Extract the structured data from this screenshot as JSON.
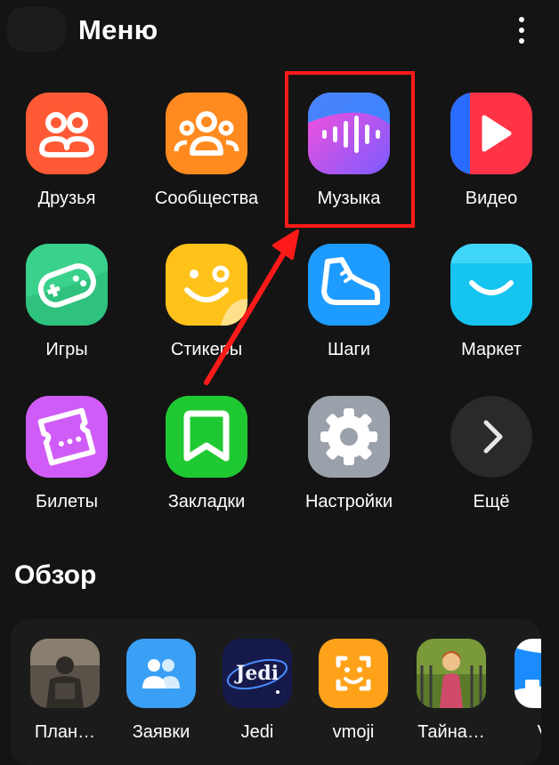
{
  "header": {
    "title": "Меню"
  },
  "menu": {
    "items": [
      {
        "label": "Друзья",
        "icon": "friends-icon",
        "color": "#ff5a36"
      },
      {
        "label": "Сообщества",
        "icon": "communities-icon",
        "color": "#ff8a1f"
      },
      {
        "label": "Музыка",
        "icon": "music-icon",
        "color": "#b35cff"
      },
      {
        "label": "Видео",
        "icon": "video-icon",
        "color": "#ff3347"
      },
      {
        "label": "Игры",
        "icon": "gamepad-icon",
        "color": "#2ec27e"
      },
      {
        "label": "Стикеры",
        "icon": "sticker-icon",
        "color": "#ffc21a"
      },
      {
        "label": "Шаги",
        "icon": "sneaker-icon",
        "color": "#1e9bff"
      },
      {
        "label": "Маркет",
        "icon": "shopping-bag-icon",
        "color": "#16c4f0"
      },
      {
        "label": "Билеты",
        "icon": "ticket-icon",
        "color": "#d05cf7"
      },
      {
        "label": "Закладки",
        "icon": "bookmark-icon",
        "color": "#1fc932"
      },
      {
        "label": "Настройки",
        "icon": "gear-icon",
        "color": "#9aa1ab"
      },
      {
        "label": "Ещё",
        "icon": "chevron-right-icon",
        "color": "#2a2a2a"
      }
    ]
  },
  "highlight": {
    "color": "#ff1a1a",
    "target": "Музыка"
  },
  "discover": {
    "title": "Обзор",
    "items": [
      {
        "label": "План…",
        "icon": "soldier-game-icon"
      },
      {
        "label": "Заявки",
        "icon": "requests-icon"
      },
      {
        "label": "Jedi",
        "icon": "jedi-game-icon",
        "icon_text": "Jedi"
      },
      {
        "label": "vmoji",
        "icon": "vmoji-icon"
      },
      {
        "label": "Тайна…",
        "icon": "mystery-game-icon"
      },
      {
        "label": "VK",
        "icon": "vk-app-icon"
      }
    ]
  }
}
